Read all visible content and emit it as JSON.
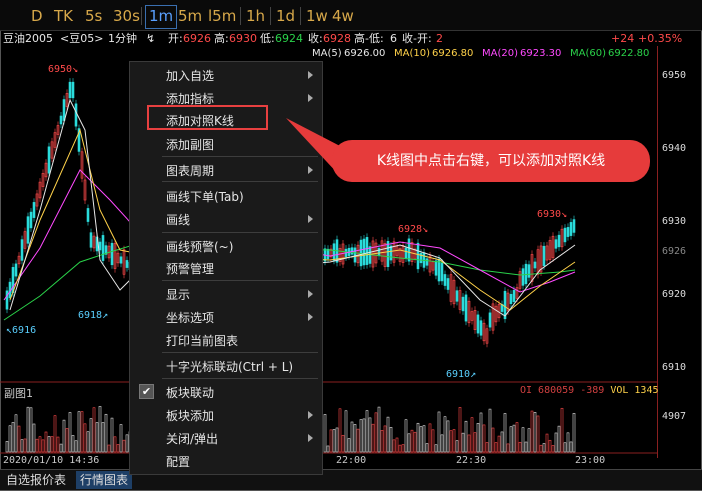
{
  "toolbar": {
    "periods": [
      "D",
      "TK",
      "5s",
      "30s",
      "1m",
      "5m",
      "l5m",
      "1h",
      "1d",
      "1w",
      "4w"
    ],
    "active": "1m"
  },
  "info": {
    "symbol": "豆油2005",
    "contract": "<豆05>",
    "interval": "1分钟",
    "open_label": "开:",
    "open": "6926",
    "high_label": "高:",
    "high": "6930",
    "low_label": "低:",
    "low": "6924",
    "close_label": "收:",
    "close": "6928",
    "hl_label": "高-低:",
    "hl": "6",
    "co_label": "收-开:",
    "co": "2",
    "change": "+24",
    "pct": "+0.35%"
  },
  "ma": [
    {
      "label": "MA(5)",
      "value": "6926.00",
      "color": "#e8e8e8"
    },
    {
      "label": "MA(10)",
      "value": "6926.80",
      "color": "#ffd24a"
    },
    {
      "label": "MA(20)",
      "value": "6923.30",
      "color": "#ff4aff"
    },
    {
      "label": "MA(60)",
      "value": "6922.80",
      "color": "#2ad24a"
    }
  ],
  "axis": {
    "ticks": [
      "6950",
      "6940",
      "6930",
      "6926",
      "6920",
      "6910",
      "4907"
    ]
  },
  "annotations": {
    "peak1": "6950",
    "peak2": "6928",
    "peak3": "6930",
    "low1": "6916",
    "low2": "6918",
    "low3": "6910"
  },
  "subchart": {
    "title": "副图1",
    "oi": "OI 680059 -389",
    "vol": "VOL 1345"
  },
  "times": [
    "2020/01/10 14:36",
    "22:00",
    "22:30",
    "23:00"
  ],
  "bottom_tabs": [
    "自选报价表",
    "行情图表"
  ],
  "menu": {
    "items": [
      {
        "label": "加入自选",
        "arrow": true
      },
      {
        "label": "添加指标",
        "arrow": true
      },
      {
        "label": "添加对照K线",
        "arrow": false
      },
      {
        "label": "添加副图",
        "arrow": false
      },
      {
        "label": "图表周期",
        "arrow": true
      },
      {
        "label": "画线下单(Tab)",
        "arrow": false
      },
      {
        "label": "画线",
        "arrow": true
      },
      {
        "label": "画线预警(~)",
        "arrow": false
      },
      {
        "label": "预警管理",
        "arrow": false
      },
      {
        "label": "显示",
        "arrow": true
      },
      {
        "label": "坐标选项",
        "arrow": true
      },
      {
        "label": "打印当前图表",
        "arrow": false
      },
      {
        "label": "十字光标联动(Ctrl + L)",
        "arrow": false
      },
      {
        "label": "板块联动",
        "arrow": false
      },
      {
        "label": "板块添加",
        "arrow": true
      },
      {
        "label": "关闭/弹出",
        "arrow": true
      },
      {
        "label": "配置",
        "arrow": false
      }
    ]
  },
  "callout": "K线图中点击右键，可以添加对照K线",
  "colors": {
    "up": "#ff4a4a",
    "down": "#2adcdc",
    "accent": "#e63b3b"
  }
}
